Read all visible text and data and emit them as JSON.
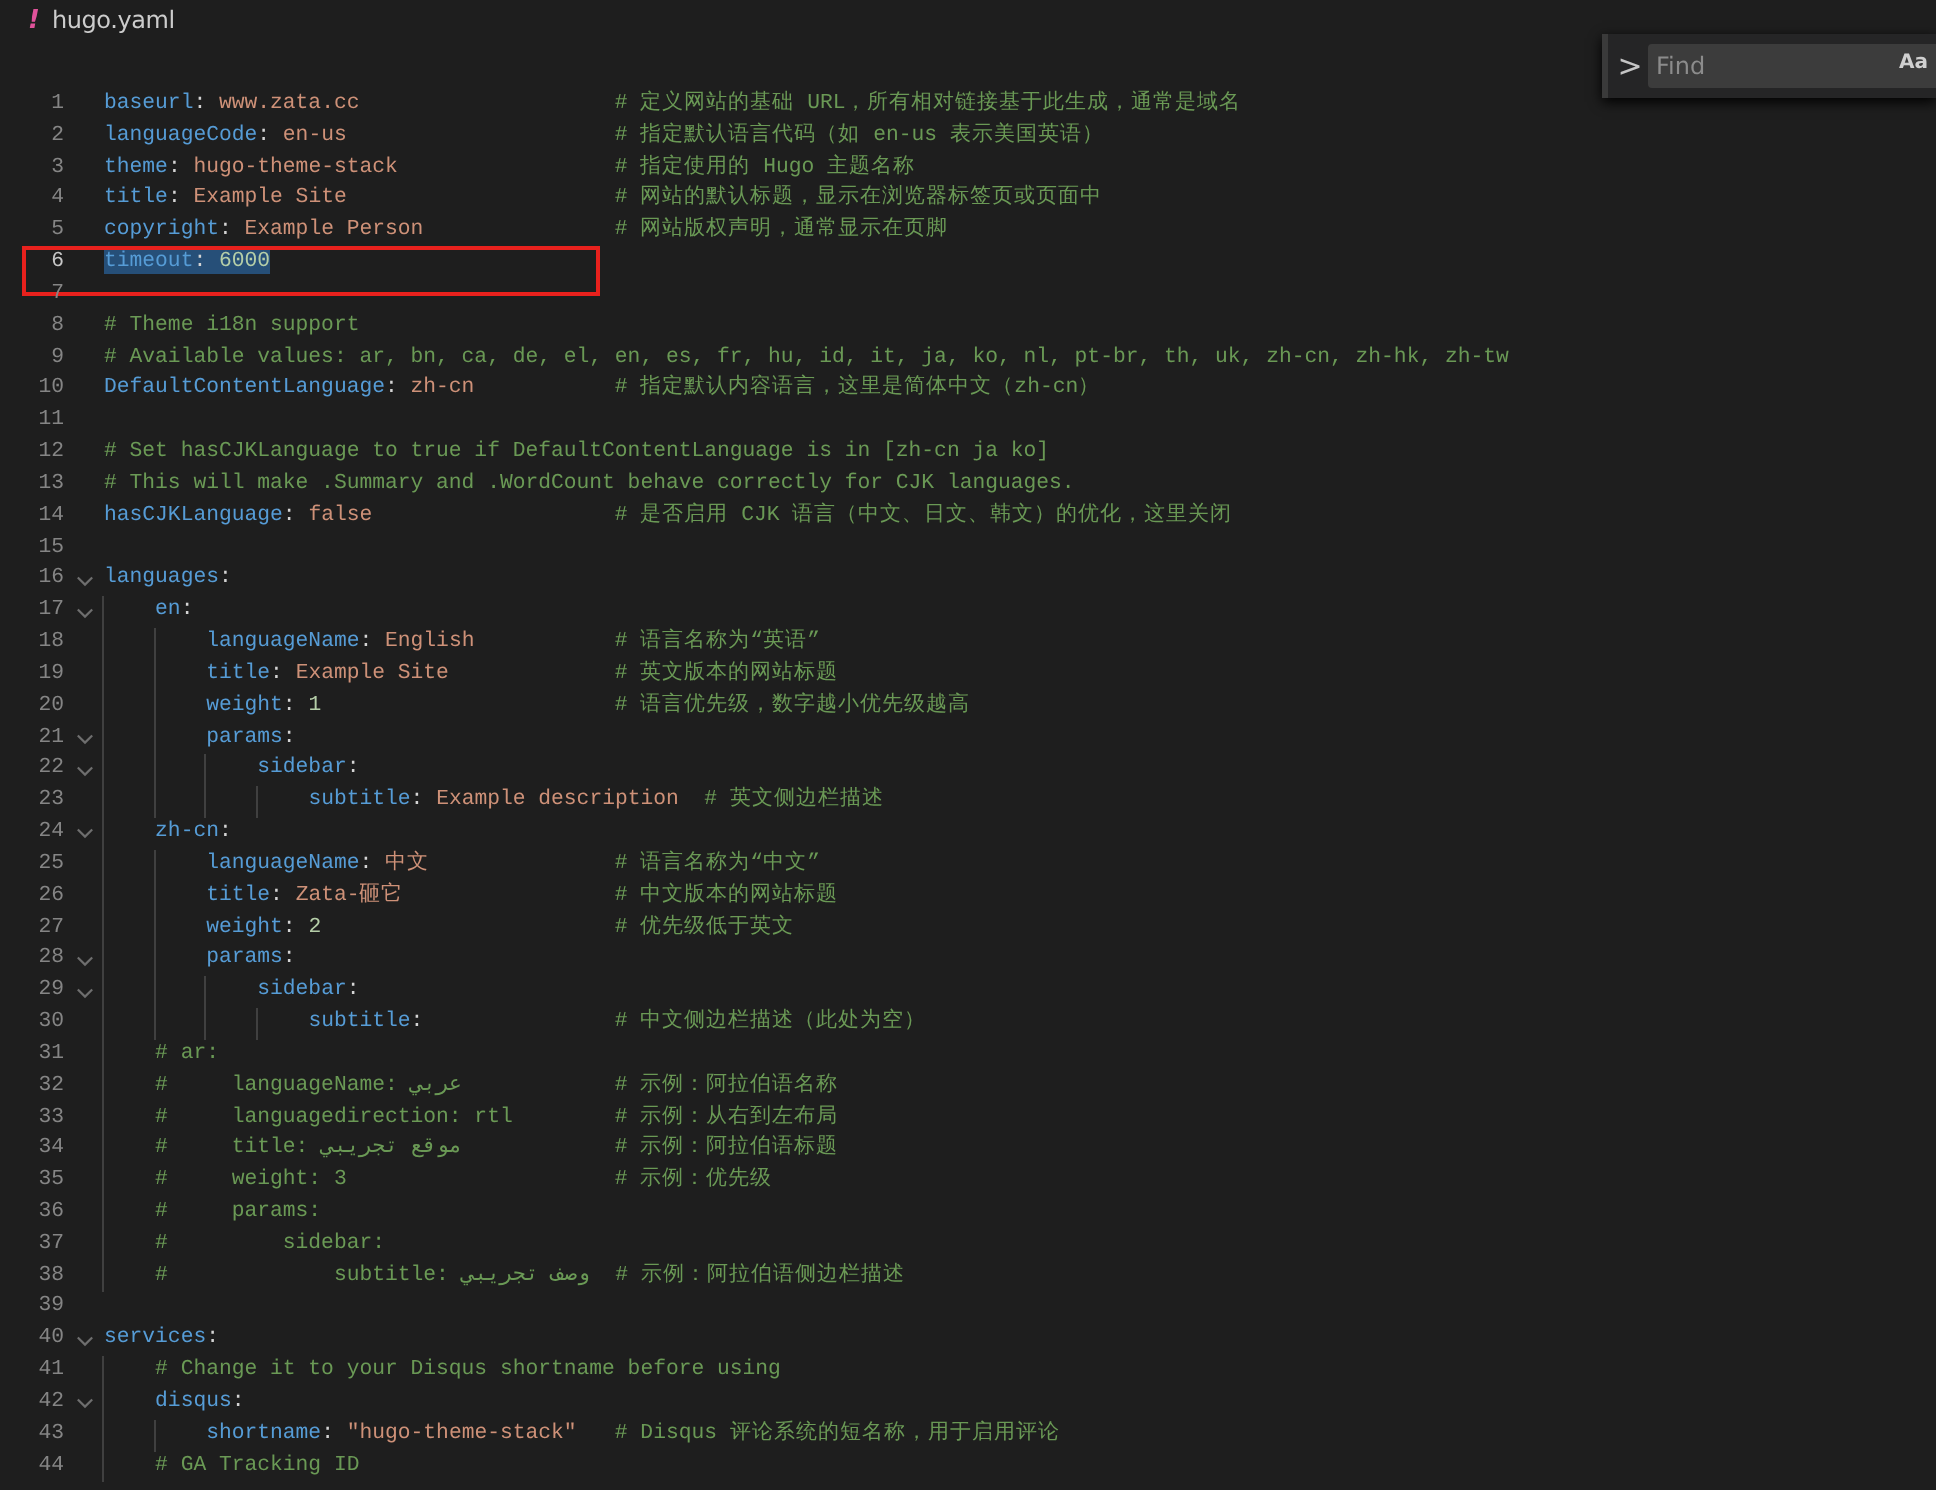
{
  "breadcrumb": {
    "file_icon": "!",
    "file_name": "hugo.yaml"
  },
  "find_widget": {
    "toggle": ">",
    "placeholder": "Find",
    "match_case": "Aa"
  },
  "lines": [
    {
      "n": "1",
      "selected": false,
      "boxed": false,
      "tokens": [
        {
          "kind": "key",
          "text": "baseurl"
        },
        {
          "kind": "punct",
          "text": ": "
        },
        {
          "kind": "string",
          "text": "www.zata.cc"
        }
      ],
      "comment": "# 定义网站的基础 URL，所有相对链接基于此生成，通常是域名"
    },
    {
      "n": "2",
      "selected": false,
      "boxed": false,
      "tokens": [
        {
          "kind": "key",
          "text": "languageCode"
        },
        {
          "kind": "punct",
          "text": ": "
        },
        {
          "kind": "string",
          "text": "en-us"
        }
      ],
      "comment": "# 指定默认语言代码（如 en-us 表示美国英语）"
    },
    {
      "n": "3",
      "selected": false,
      "boxed": false,
      "tokens": [
        {
          "kind": "key",
          "text": "theme"
        },
        {
          "kind": "punct",
          "text": ": "
        },
        {
          "kind": "string",
          "text": "hugo-theme-stack"
        }
      ],
      "comment": "# 指定使用的 Hugo 主题名称"
    },
    {
      "n": "4",
      "selected": false,
      "boxed": false,
      "tokens": [
        {
          "kind": "key",
          "text": "title"
        },
        {
          "kind": "punct",
          "text": ": "
        },
        {
          "kind": "string",
          "text": "Example Site"
        }
      ],
      "comment": "# 网站的默认标题，显示在浏览器标签页或页面中"
    },
    {
      "n": "5",
      "selected": false,
      "boxed": false,
      "tokens": [
        {
          "kind": "key",
          "text": "copyright"
        },
        {
          "kind": "punct",
          "text": ": "
        },
        {
          "kind": "string",
          "text": "Example Person"
        }
      ],
      "comment": "# 网站版权声明，通常显示在页脚"
    },
    {
      "n": "6",
      "selected": true,
      "boxed": true,
      "tokens": [
        {
          "kind": "key",
          "text": "timeout"
        },
        {
          "kind": "punct",
          "text": ": "
        },
        {
          "kind": "number",
          "text": "6000"
        }
      ]
    },
    {
      "n": "7",
      "selected": false,
      "boxed": false
    },
    {
      "n": "8",
      "selected": false,
      "boxed": false,
      "tokens": [
        {
          "kind": "comment",
          "text": "# Theme i18n support"
        }
      ]
    },
    {
      "n": "9",
      "selected": false,
      "boxed": false,
      "tokens": [
        {
          "kind": "comment",
          "text": "# Available values: ar, bn, ca, de, el, en, es, fr, hu, id, it, ja, ko, nl, pt-br, th, uk, zh-cn, zh-hk, zh-tw"
        }
      ]
    },
    {
      "n": "10",
      "selected": false,
      "boxed": false,
      "tokens": [
        {
          "kind": "key",
          "text": "DefaultContentLanguage"
        },
        {
          "kind": "punct",
          "text": ": "
        },
        {
          "kind": "string",
          "text": "zh-cn"
        }
      ],
      "comment": "# 指定默认内容语言，这里是简体中文（zh-cn）"
    },
    {
      "n": "11",
      "selected": false,
      "boxed": false
    },
    {
      "n": "12",
      "selected": false,
      "boxed": false,
      "tokens": [
        {
          "kind": "comment",
          "text": "# Set hasCJKLanguage to true if DefaultContentLanguage is in [zh-cn ja ko]"
        }
      ]
    },
    {
      "n": "13",
      "selected": false,
      "boxed": false,
      "tokens": [
        {
          "kind": "comment",
          "text": "# This will make .Summary and .WordCount behave correctly for CJK languages."
        }
      ]
    },
    {
      "n": "14",
      "selected": false,
      "boxed": false,
      "tokens": [
        {
          "kind": "key",
          "text": "hasCJKLanguage"
        },
        {
          "kind": "punct",
          "text": ": "
        },
        {
          "kind": "string",
          "text": "false"
        }
      ],
      "comment": "# 是否启用 CJK 语言（中文、日文、韩文）的优化，这里关闭"
    },
    {
      "n": "15",
      "selected": false,
      "boxed": false
    },
    {
      "n": "16",
      "selected": false,
      "boxed": false,
      "expanded": true,
      "tokens": [
        {
          "kind": "key",
          "text": "languages"
        },
        {
          "kind": "punct",
          "text": ":"
        }
      ]
    },
    {
      "n": "17",
      "selected": false,
      "boxed": false,
      "expanded": true,
      "tokens": [
        {
          "kind": "key",
          "text": "    en"
        },
        {
          "kind": "punct",
          "text": ":"
        }
      ]
    },
    {
      "n": "18",
      "selected": false,
      "boxed": false,
      "tokens": [
        {
          "kind": "key",
          "text": "        languageName"
        },
        {
          "kind": "punct",
          "text": ": "
        },
        {
          "kind": "string",
          "text": "English"
        }
      ],
      "comment": "# 语言名称为“英语”"
    },
    {
      "n": "19",
      "selected": false,
      "boxed": false,
      "tokens": [
        {
          "kind": "key",
          "text": "        title"
        },
        {
          "kind": "punct",
          "text": ": "
        },
        {
          "kind": "string",
          "text": "Example Site"
        }
      ],
      "comment": "# 英文版本的网站标题"
    },
    {
      "n": "20",
      "selected": false,
      "boxed": false,
      "tokens": [
        {
          "kind": "key",
          "text": "        weight"
        },
        {
          "kind": "punct",
          "text": ": "
        },
        {
          "kind": "number",
          "text": "1"
        }
      ],
      "comment": "# 语言优先级，数字越小优先级越高"
    },
    {
      "n": "21",
      "selected": false,
      "boxed": false,
      "expanded": true,
      "tokens": [
        {
          "kind": "key",
          "text": "        params"
        },
        {
          "kind": "punct",
          "text": ":"
        }
      ]
    },
    {
      "n": "22",
      "selected": false,
      "boxed": false,
      "expanded": true,
      "tokens": [
        {
          "kind": "key",
          "text": "            sidebar"
        },
        {
          "kind": "punct",
          "text": ":"
        }
      ]
    },
    {
      "n": "23",
      "selected": false,
      "boxed": false,
      "tokens": [
        {
          "kind": "key",
          "text": "                subtitle"
        },
        {
          "kind": "punct",
          "text": ": "
        },
        {
          "kind": "string",
          "text": "Example description"
        }
      ],
      "comment": "# 英文侧边栏描述"
    },
    {
      "n": "24",
      "selected": false,
      "boxed": false,
      "expanded": true,
      "tokens": [
        {
          "kind": "key",
          "text": "    zh-cn"
        },
        {
          "kind": "punct",
          "text": ":"
        }
      ]
    },
    {
      "n": "25",
      "selected": false,
      "boxed": false,
      "tokens": [
        {
          "kind": "key",
          "text": "        languageName"
        },
        {
          "kind": "punct",
          "text": ": "
        },
        {
          "kind": "string",
          "text": "中文"
        }
      ],
      "comment": "# 语言名称为“中文”"
    },
    {
      "n": "26",
      "selected": false,
      "boxed": false,
      "tokens": [
        {
          "kind": "key",
          "text": "        title"
        },
        {
          "kind": "punct",
          "text": ": "
        },
        {
          "kind": "string",
          "text": "Zata-砸它"
        }
      ],
      "comment": "# 中文版本的网站标题"
    },
    {
      "n": "27",
      "selected": false,
      "boxed": false,
      "tokens": [
        {
          "kind": "key",
          "text": "        weight"
        },
        {
          "kind": "punct",
          "text": ": "
        },
        {
          "kind": "number",
          "text": "2"
        }
      ],
      "comment": "# 优先级低于英文"
    },
    {
      "n": "28",
      "selected": false,
      "boxed": false,
      "expanded": true,
      "tokens": [
        {
          "kind": "key",
          "text": "        params"
        },
        {
          "kind": "punct",
          "text": ":"
        }
      ]
    },
    {
      "n": "29",
      "selected": false,
      "boxed": false,
      "expanded": true,
      "tokens": [
        {
          "kind": "key",
          "text": "            sidebar"
        },
        {
          "kind": "punct",
          "text": ":"
        }
      ]
    },
    {
      "n": "30",
      "selected": false,
      "boxed": false,
      "tokens": [
        {
          "kind": "key",
          "text": "                subtitle"
        },
        {
          "kind": "punct",
          "text": ":"
        }
      ],
      "comment": "# 中文侧边栏描述（此处为空）"
    },
    {
      "n": "31",
      "selected": false,
      "boxed": false,
      "tokens": [
        {
          "kind": "comment",
          "text": "    # ar:"
        }
      ]
    },
    {
      "n": "32",
      "selected": false,
      "boxed": false,
      "tokens": [
        {
          "kind": "comment",
          "text": "    #     languageName: عربي"
        }
      ],
      "comment": "# 示例：阿拉伯语名称"
    },
    {
      "n": "33",
      "selected": false,
      "boxed": false,
      "tokens": [
        {
          "kind": "comment",
          "text": "    #     languagedirection: rtl"
        }
      ],
      "comment": "# 示例：从右到左布局"
    },
    {
      "n": "34",
      "selected": false,
      "boxed": false,
      "tokens": [
        {
          "kind": "comment",
          "text": "    #     title: موقع تجريبي"
        }
      ],
      "comment": "# 示例：阿拉伯语标题"
    },
    {
      "n": "35",
      "selected": false,
      "boxed": false,
      "tokens": [
        {
          "kind": "comment",
          "text": "    #     weight: 3"
        }
      ],
      "comment": "# 示例：优先级"
    },
    {
      "n": "36",
      "selected": false,
      "boxed": false,
      "tokens": [
        {
          "kind": "comment",
          "text": "    #     params:"
        }
      ]
    },
    {
      "n": "37",
      "selected": false,
      "boxed": false,
      "tokens": [
        {
          "kind": "comment",
          "text": "    #         sidebar:"
        }
      ]
    },
    {
      "n": "38",
      "selected": false,
      "boxed": false,
      "tokens": [
        {
          "kind": "comment",
          "text": "    #             subtitle: وصف تجريبي"
        }
      ],
      "comment": "# 示例：阿拉伯语侧边栏描述"
    },
    {
      "n": "39",
      "selected": false,
      "boxed": false
    },
    {
      "n": "40",
      "selected": false,
      "boxed": false,
      "expanded": true,
      "tokens": [
        {
          "kind": "key",
          "text": "services"
        },
        {
          "kind": "punct",
          "text": ":"
        }
      ]
    },
    {
      "n": "41",
      "selected": false,
      "boxed": false,
      "tokens": [
        {
          "kind": "comment",
          "text": "    # Change it to your Disqus shortname before using"
        }
      ]
    },
    {
      "n": "42",
      "selected": false,
      "boxed": false,
      "expanded": true,
      "tokens": [
        {
          "kind": "key",
          "text": "    disqus"
        },
        {
          "kind": "punct",
          "text": ":"
        }
      ]
    },
    {
      "n": "43",
      "selected": false,
      "boxed": false,
      "tokens": [
        {
          "kind": "key",
          "text": "        shortname"
        },
        {
          "kind": "punct",
          "text": ": "
        },
        {
          "kind": "string",
          "text": "\"hugo-theme-stack\""
        }
      ],
      "comment": "# Disqus 评论系统的短名称，用于启用评论"
    },
    {
      "n": "44",
      "selected": false,
      "boxed": false,
      "tokens": [
        {
          "kind": "comment",
          "text": "    # GA Tracking ID"
        }
      ]
    }
  ]
}
